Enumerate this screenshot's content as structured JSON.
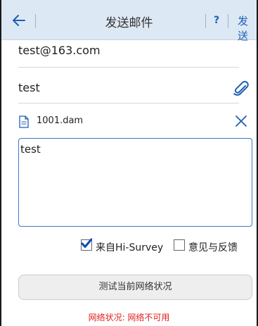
{
  "header": {
    "title": "发送邮件",
    "help_label": "?",
    "send_label": "发送"
  },
  "form": {
    "to": "test@163.com",
    "subject": "test",
    "attachment_name": "1001.dam",
    "body": "test"
  },
  "options": {
    "from_hisurvey_label": "来自Hi-Survey",
    "from_hisurvey_checked": true,
    "feedback_label": "意见与反馈",
    "feedback_checked": false
  },
  "network": {
    "test_button_label": "测试当前网络状况",
    "status_text": "网络状况: 网络不可用"
  },
  "colors": {
    "accent": "#1e5fb3",
    "header_bg": "#dde8f5",
    "error": "#e02020"
  },
  "icons": {
    "back": "back-arrow-icon",
    "attach": "paperclip-icon",
    "file": "file-icon",
    "remove": "close-icon",
    "check": "checkmark-icon"
  }
}
